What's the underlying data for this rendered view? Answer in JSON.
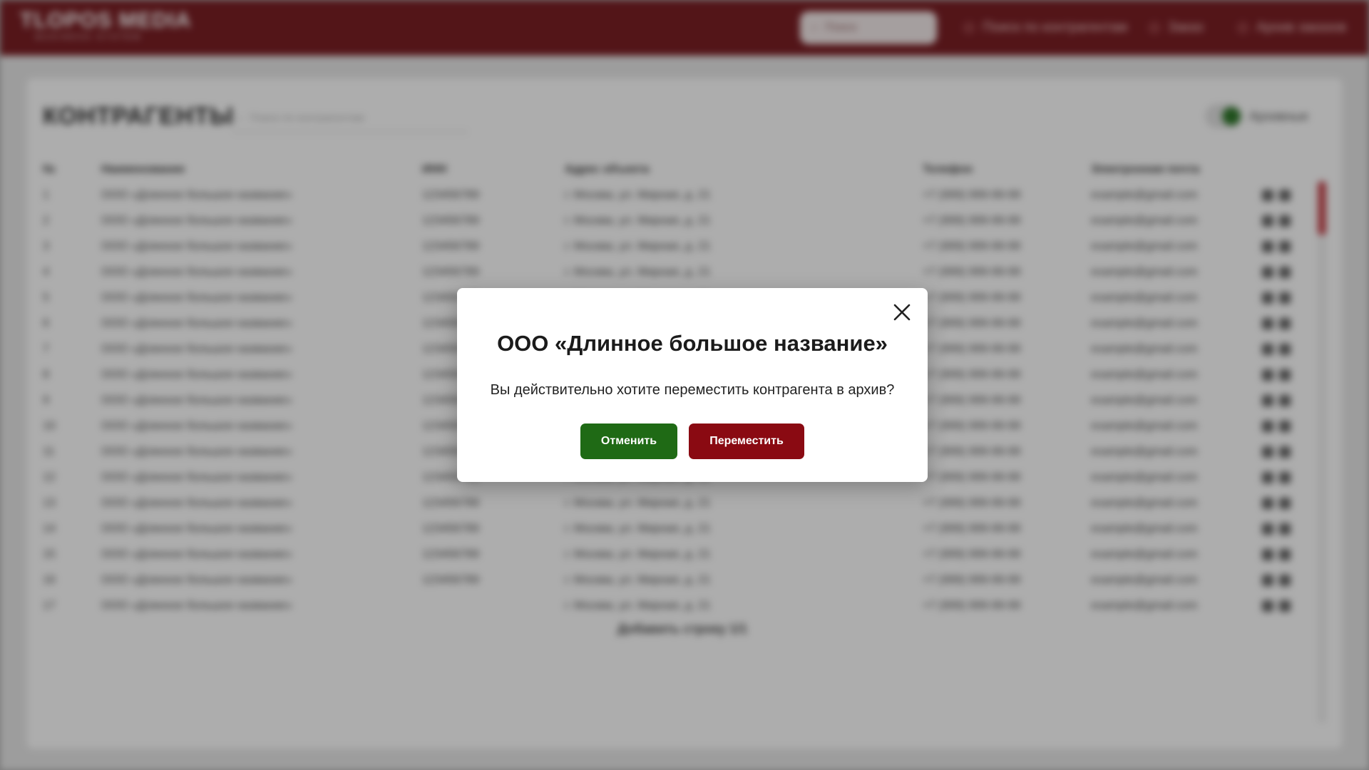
{
  "header": {
    "logo_main": "TLOPOS MEDIA",
    "logo_sub": "BUSINESS SYSTEM",
    "search_label": "Поиск",
    "links": [
      "Поиск по контрагентам",
      "Заказ",
      "Архив заказов"
    ]
  },
  "page": {
    "title": "КОНТРАГЕНТЫ",
    "search_placeholder": "Поиск по контрагентам",
    "archive_label": "Архивные"
  },
  "table": {
    "columns": [
      "№",
      "Наименование",
      "ИНН",
      "Адрес объекта",
      "Телефон",
      "Электронная почта"
    ],
    "rows": [
      [
        "1",
        "ООО «Длинное большое название»",
        "123456789",
        "г. Москва, ул. Мирная, д. 21",
        "+7 (999) 999-99-99",
        "example@gmail.com"
      ],
      [
        "2",
        "ООО «Длинное большое название»",
        "123456789",
        "г. Москва, ул. Мирная, д. 21",
        "+7 (999) 999-99-99",
        "example@gmail.com"
      ],
      [
        "3",
        "ООО «Длинное большое название»",
        "123456789",
        "г. Москва, ул. Мирная, д. 21",
        "+7 (999) 999-99-99",
        "example@gmail.com"
      ],
      [
        "4",
        "ООО «Длинное большое название»",
        "123456789",
        "г. Москва, ул. Мирная, д. 21",
        "+7 (999) 999-99-99",
        "example@gmail.com"
      ],
      [
        "5",
        "ООО «Длинное большое название»",
        "123456789",
        "г. Москва, ул. Мирная, д. 21",
        "+7 (999) 999-99-99",
        "example@gmail.com"
      ],
      [
        "6",
        "ООО «Длинное большое название»",
        "123456789",
        "г. Москва, ул. Мирная, д. 21",
        "+7 (999) 999-99-99",
        "example@gmail.com"
      ],
      [
        "7",
        "ООО «Длинное большое название»",
        "123456789",
        "г. Москва, ул. Мирная, д. 21",
        "+7 (999) 999-99-99",
        "example@gmail.com"
      ],
      [
        "8",
        "ООО «Длинное большое название»",
        "123456789",
        "г. Москва, ул. Мирная, д. 21",
        "+7 (999) 999-99-99",
        "example@gmail.com"
      ],
      [
        "9",
        "ООО «Длинное большое название»",
        "123456789",
        "г. Москва, ул. Мирная, д. 21",
        "+7 (999) 999-99-99",
        "example@gmail.com"
      ],
      [
        "10",
        "ООО «Длинное большое название»",
        "123456789",
        "г. Москва, ул. Мирная, д. 21",
        "+7 (999) 999-99-99",
        "example@gmail.com"
      ],
      [
        "11",
        "ООО «Длинное большое название»",
        "123456789",
        "г. Москва, ул. Мирная, д. 21",
        "+7 (999) 999-99-99",
        "example@gmail.com"
      ],
      [
        "12",
        "ООО «Длинное большое название»",
        "123456789",
        "г. Москва, ул. Мирная, д. 21",
        "+7 (999) 999-99-99",
        "example@gmail.com"
      ],
      [
        "13",
        "ООО «Длинное большое название»",
        "123456789",
        "г. Москва, ул. Мирная, д. 21",
        "+7 (999) 999-99-99",
        "example@gmail.com"
      ],
      [
        "14",
        "ООО «Длинное большое название»",
        "123456789",
        "г. Москва, ул. Мирная, д. 21",
        "+7 (999) 999-99-99",
        "example@gmail.com"
      ],
      [
        "15",
        "ООО «Длинное большое название»",
        "123456789",
        "г. Москва, ул. Мирная, д. 21",
        "+7 (999) 999-99-99",
        "example@gmail.com"
      ],
      [
        "16",
        "ООО «Длинное большое название»",
        "123456789",
        "г. Москва, ул. Мирная, д. 21",
        "+7 (999) 999-99-99",
        "example@gmail.com"
      ],
      [
        "17",
        "ООО «Длинное большое название»",
        "",
        "г. Москва, ул. Мирная, д. 21",
        "+7 (999) 999-99-99",
        "example@gmail.com"
      ]
    ],
    "pager": "Добавить строку 1/1"
  },
  "modal": {
    "title": "ООО «Длинное большое название»",
    "text": "Вы действительно хотите переместить контрагента в архив?",
    "cancel_label": "Отменить",
    "confirm_label": "Переместить"
  },
  "colors": {
    "header_bg": "#6e0a10",
    "cancel_bg": "#1f6a15",
    "confirm_bg": "#8a0a12"
  }
}
